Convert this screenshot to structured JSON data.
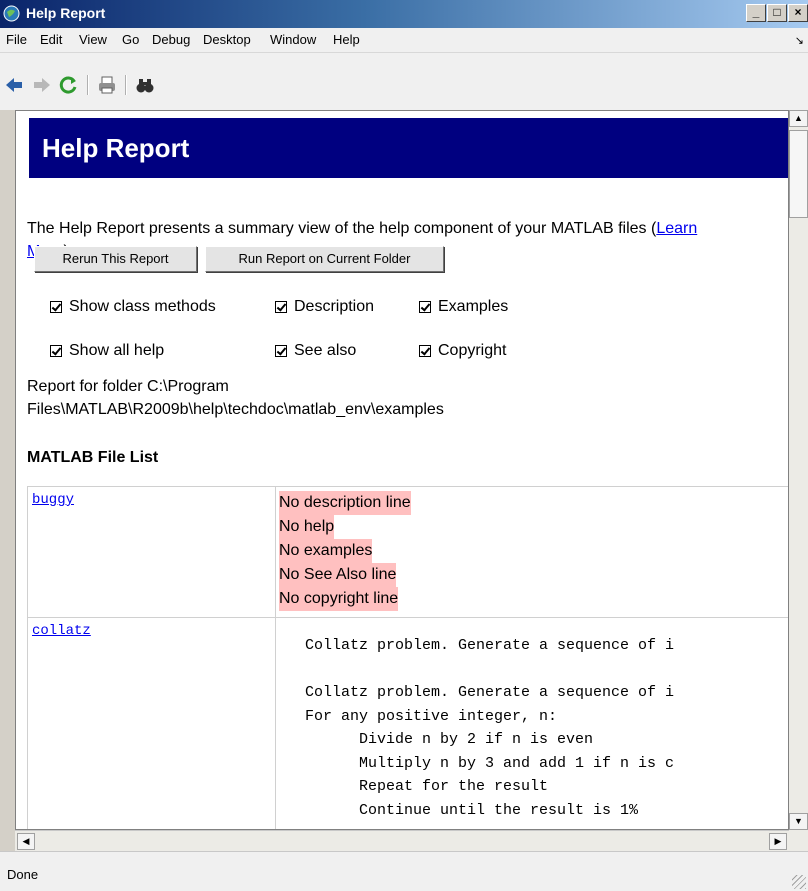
{
  "window": {
    "title": "Help Report"
  },
  "menu": [
    "File",
    "Edit",
    "View",
    "Go",
    "Debug",
    "Desktop",
    "Window",
    "Help"
  ],
  "toolbar_icons": [
    "back-arrow-icon",
    "forward-arrow-icon",
    "refresh-icon",
    "print-icon",
    "find-binoculars-icon"
  ],
  "report": {
    "banner": "Help Report",
    "intro_text": "The Help Report presents a summary view of the help component of your MATLAB files (",
    "learn_more": "Learn More",
    "intro_end": ").",
    "rerun_label": "Rerun This Report",
    "run_current_label": "Run Report on Current Folder",
    "checkboxes": [
      {
        "label": "Show class methods",
        "checked": true
      },
      {
        "label": "Description",
        "checked": true
      },
      {
        "label": "Examples",
        "checked": true
      },
      {
        "label": "Show all help",
        "checked": true
      },
      {
        "label": "See also",
        "checked": true
      },
      {
        "label": "Copyright",
        "checked": true
      }
    ],
    "folder_line1": "Report for folder C:\\Program",
    "folder_line2": "Files\\MATLAB\\R2009b\\help\\techdoc\\matlab_env\\examples",
    "section_title": "MATLAB File List",
    "files": [
      {
        "name": "buggy",
        "issues": [
          "No description line",
          "No help",
          "No examples",
          "No See Also line",
          "No copyright line"
        ]
      },
      {
        "name": "collatz",
        "help": "Collatz problem. Generate a sequence of i\n\nCollatz problem. Generate a sequence of i\nFor any positive integer, n:\n      Divide n by 2 if n is even\n      Multiply n by 3 and add 1 if n is c\n      Repeat for the result\n      Continue until the result is 1%"
      }
    ]
  },
  "status": {
    "text": "Done"
  },
  "colors": {
    "banner_bg": "#000080",
    "issue_bg": "#ffc0c0",
    "link": "#0000ee"
  }
}
